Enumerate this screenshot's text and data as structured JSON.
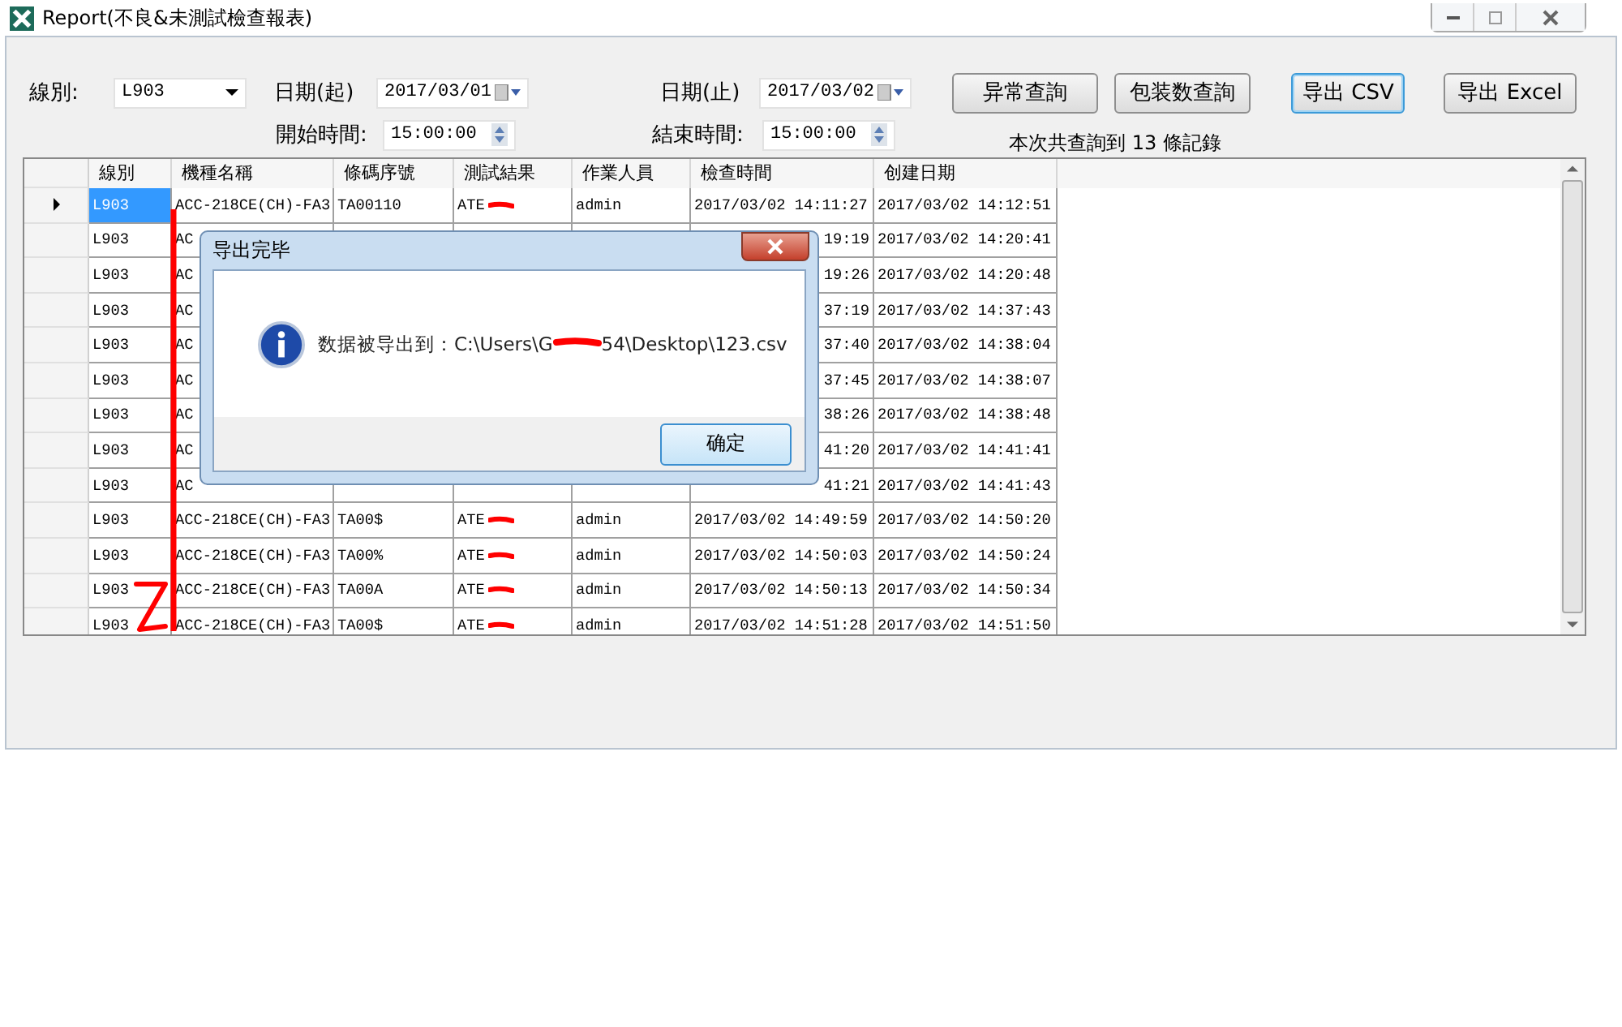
{
  "window": {
    "title": "Report(不良&未測試檢查報表)"
  },
  "filters": {
    "line_label": "線別:",
    "line_value": "L903",
    "start_date_label": "日期(起)",
    "start_date": "2017/03/01",
    "end_date_label": "日期(止)",
    "end_date": "2017/03/02",
    "start_time_label": "開始時間:",
    "start_time": "15:00:00",
    "end_time_label": "結束時間:",
    "end_time": "15:00:00"
  },
  "buttons": [
    {
      "label": "异常查詢",
      "focused": false
    },
    {
      "label": "包装数查詢",
      "focused": false
    },
    {
      "label": "导出 CSV",
      "focused": true
    },
    {
      "label": "导出 Excel",
      "focused": false
    }
  ],
  "record_count": "本次共查詢到 13 條記錄",
  "table": {
    "columns": [
      "線別",
      "機種名稱",
      "條碼序號",
      "測試結果",
      "作業人員",
      "檢查時間",
      "创建日期"
    ],
    "rows": [
      {
        "kind": "full",
        "selected": true,
        "cells": [
          "L903",
          "ACC-218CE(CH)-FA3",
          "TA00110",
          "ATE",
          "admin",
          "2017/03/02 14:11:27",
          "2017/03/02 14:12:51"
        ]
      },
      {
        "kind": "covered",
        "selected": false,
        "line": "L903",
        "model": "AC",
        "check_time": "19:19",
        "created": "2017/03/02 14:20:41"
      },
      {
        "kind": "covered",
        "selected": false,
        "line": "L903",
        "model": "AC",
        "check_time": "19:26",
        "created": "2017/03/02 14:20:48"
      },
      {
        "kind": "covered",
        "selected": false,
        "line": "L903",
        "model": "AC",
        "check_time": "37:19",
        "created": "2017/03/02 14:37:43"
      },
      {
        "kind": "covered",
        "selected": false,
        "line": "L903",
        "model": "AC",
        "check_time": "37:40",
        "created": "2017/03/02 14:38:04"
      },
      {
        "kind": "covered",
        "selected": false,
        "line": "L903",
        "model": "AC",
        "check_time": "37:45",
        "created": "2017/03/02 14:38:07"
      },
      {
        "kind": "covered",
        "selected": false,
        "line": "L903",
        "model": "AC",
        "check_time": "38:26",
        "created": "2017/03/02 14:38:48"
      },
      {
        "kind": "covered",
        "selected": false,
        "line": "L903",
        "model": "AC",
        "check_time": "41:20",
        "created": "2017/03/02 14:41:41"
      },
      {
        "kind": "covered",
        "selected": false,
        "line": "L903",
        "model": "AC",
        "check_time": "41:21",
        "created": "2017/03/02 14:41:43"
      },
      {
        "kind": "full",
        "selected": false,
        "cells": [
          "L903",
          "ACC-218CE(CH)-FA3",
          "TA00$",
          "ATE",
          "admin",
          "2017/03/02 14:49:59",
          "2017/03/02 14:50:20"
        ]
      },
      {
        "kind": "full",
        "selected": false,
        "cells": [
          "L903",
          "ACC-218CE(CH)-FA3",
          "TA00%",
          "ATE",
          "admin",
          "2017/03/02 14:50:03",
          "2017/03/02 14:50:24"
        ]
      },
      {
        "kind": "full",
        "selected": false,
        "cells": [
          "L903",
          "ACC-218CE(CH)-FA3",
          "TA00A",
          "ATE",
          "admin",
          "2017/03/02 14:50:13",
          "2017/03/02 14:50:34"
        ]
      },
      {
        "kind": "full",
        "selected": false,
        "cells": [
          "L903",
          "ACC-218CE(CH)-FA3",
          "TA00$",
          "ATE",
          "admin",
          "2017/03/02 14:51:28",
          "2017/03/02 14:51:50"
        ]
      }
    ]
  },
  "dialog": {
    "title": "导出完毕",
    "message_start": "数据被导出到：C:\\Users\\G",
    "message_end": "54\\Desktop\\123.csv",
    "ok": "确定"
  }
}
